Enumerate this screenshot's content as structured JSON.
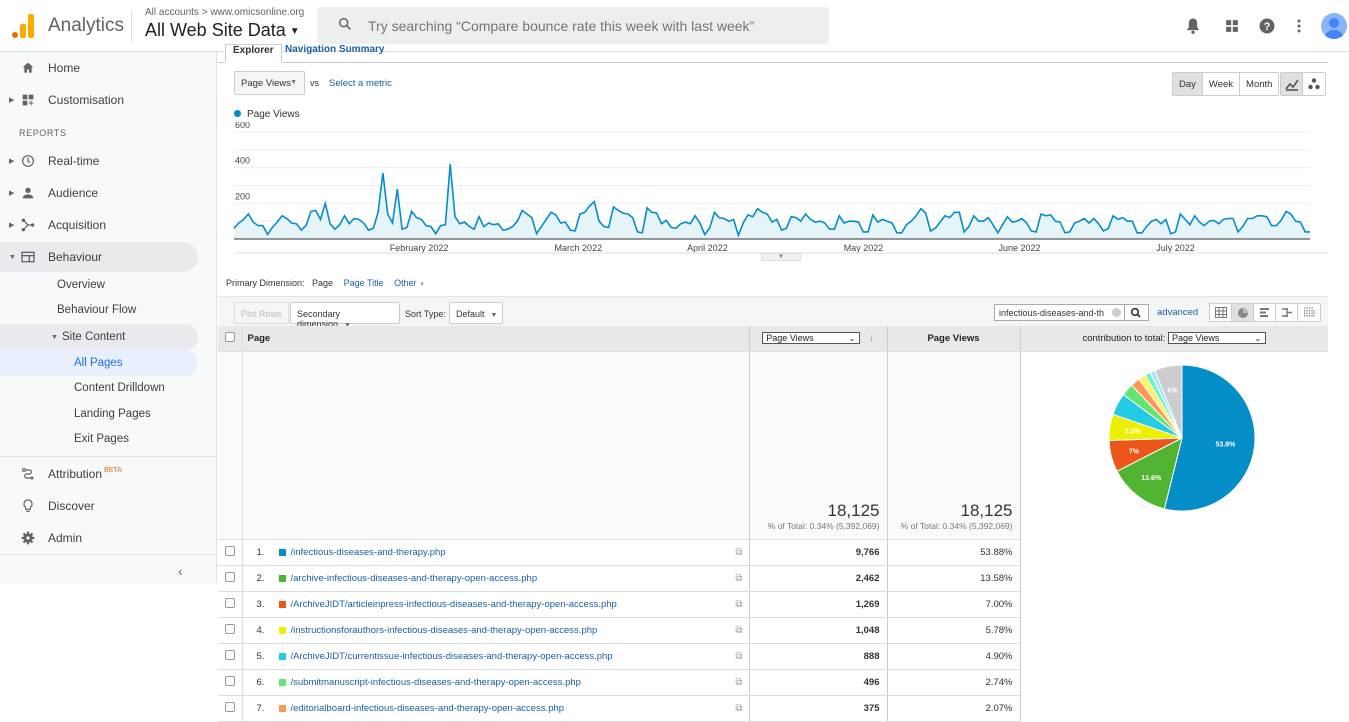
{
  "header": {
    "app_name": "Analytics",
    "breadcrumb": "All accounts > www.omicsonline.org",
    "property": "All Web Site Data",
    "search_placeholder": "Try searching “Compare bounce rate this week with last week”",
    "icons": [
      "bell-icon",
      "apps-grid-icon",
      "help-icon",
      "more-vert-icon",
      "avatar"
    ]
  },
  "sidebar": {
    "items": [
      {
        "label": "Home",
        "icon": "home-icon"
      },
      {
        "label": "Customisation",
        "icon": "dashboard-icon"
      },
      {
        "label": "Real-time",
        "icon": "clock-icon"
      },
      {
        "label": "Audience",
        "icon": "person-icon"
      },
      {
        "label": "Acquisition",
        "icon": "acquisition-icon"
      },
      {
        "label": "Behaviour",
        "icon": "behaviour-icon"
      }
    ],
    "reports_label": "REPORTS",
    "behaviour_sub": [
      "Overview",
      "Behaviour Flow",
      "Site Content"
    ],
    "site_content_sub": [
      "All Pages",
      "Content Drilldown",
      "Landing Pages",
      "Exit Pages"
    ],
    "bottom": [
      {
        "label": "Attribution",
        "badge": "BETA",
        "icon": "attribution-icon"
      },
      {
        "label": "Discover",
        "icon": "lightbulb-icon"
      },
      {
        "label": "Admin",
        "icon": "gear-icon"
      }
    ]
  },
  "explorer": {
    "tabs": [
      "Explorer",
      "Navigation Summary"
    ],
    "metric": "Page Views",
    "vs": "vs",
    "select_metric": "Select a metric",
    "granularity": [
      "Day",
      "Week",
      "Month"
    ],
    "granularity_selected": "Day"
  },
  "chart_data": {
    "type": "area",
    "series": [
      {
        "name": "Page Views",
        "color": "#058dc7"
      }
    ],
    "yticks": [
      "600",
      "400",
      "200"
    ],
    "ylim": [
      0,
      600
    ],
    "x_labels": [
      "February 2022",
      "March 2022",
      "April 2022",
      "May 2022",
      "June 2022",
      "July 2022"
    ],
    "values": [
      60,
      90,
      110,
      140,
      95,
      75,
      75,
      25,
      65,
      95,
      130,
      115,
      90,
      85,
      50,
      75,
      155,
      160,
      110,
      200,
      85,
      55,
      80,
      130,
      85,
      115,
      110,
      90,
      50,
      60,
      150,
      370,
      140,
      90,
      280,
      55,
      65,
      155,
      120,
      110,
      75,
      70,
      30,
      75,
      80,
      420,
      125,
      85,
      95,
      70,
      55,
      125,
      70,
      90,
      80,
      85,
      50,
      55,
      70,
      100,
      160,
      140,
      120,
      30,
      70,
      110,
      150,
      135,
      90,
      95,
      50,
      45,
      140,
      150,
      185,
      210,
      100,
      70,
      65,
      180,
      160,
      145,
      140,
      120,
      40,
      35,
      175,
      150,
      145,
      85,
      105,
      65,
      60,
      85,
      95,
      85,
      130,
      90,
      25,
      60,
      150,
      120,
      115,
      100,
      110,
      20,
      90,
      135,
      125,
      170,
      150,
      140,
      95,
      110,
      50,
      60,
      125,
      120,
      100,
      140,
      110,
      95,
      100,
      90,
      55,
      55,
      130,
      90,
      100,
      100,
      95,
      40,
      40,
      135,
      95,
      110,
      100,
      90,
      35,
      35,
      80,
      100,
      130,
      170,
      145,
      45,
      60,
      95,
      130,
      120,
      150,
      150,
      40,
      70,
      130,
      100,
      100,
      120,
      80,
      35,
      80,
      125,
      95,
      100,
      115,
      90,
      45,
      40,
      140,
      130,
      135,
      100,
      95,
      35,
      40,
      90,
      100,
      115,
      90,
      115,
      85,
      45,
      60,
      130,
      110,
      120,
      100,
      100,
      35,
      35,
      70,
      100,
      110,
      85,
      110,
      30,
      40,
      140,
      110,
      80,
      130,
      95,
      75,
      100,
      105,
      85,
      110,
      115,
      115,
      40,
      70,
      115,
      115,
      130,
      130,
      125,
      75,
      75,
      105,
      155,
      140,
      100,
      95,
      40,
      40
    ]
  },
  "primary_dimension": {
    "label": "Primary Dimension:",
    "current": "Page",
    "options": [
      "Page Title",
      "Other"
    ]
  },
  "toolbar": {
    "plot_rows": "Plot Rows",
    "secondary_dimension": "Secondary dimension",
    "sort_type_label": "Sort Type:",
    "sort_type": "Default",
    "filter_value": "infectious-diseases-and-th",
    "advanced": "advanced"
  },
  "table": {
    "col_page": "Page",
    "col_metric_select": "Page Views",
    "col_metric": "Page Views",
    "contribution_label": "contribution to total:",
    "contribution_select": "Page Views",
    "totals": {
      "value1": "18,125",
      "sub1": "% of Total: 0.34% (5,392,069)",
      "value2": "18,125",
      "sub2": "% of Total: 0.34% (5,392,069)"
    },
    "rows": [
      {
        "n": "1.",
        "page": "/infectious-diseases-and-therapy.php",
        "views": "9,766",
        "pct": "53.88%",
        "color": "#058dc7"
      },
      {
        "n": "2.",
        "page": "/archive-infectious-diseases-and-therapy-open-access.php",
        "views": "2,462",
        "pct": "13.58%",
        "color": "#50b432"
      },
      {
        "n": "3.",
        "page": "/ArchiveJIDT/articleinpress-infectious-diseases-and-therapy-open-access.php",
        "views": "1,269",
        "pct": "7.00%",
        "color": "#ed561b"
      },
      {
        "n": "4.",
        "page": "/instructionsforauthors-infectious-diseases-and-therapy-open-access.php",
        "views": "1,048",
        "pct": "5.78%",
        "color": "#edef00"
      },
      {
        "n": "5.",
        "page": "/ArchiveJIDT/currentissue-infectious-diseases-and-therapy-open-access.php",
        "views": "888",
        "pct": "4.90%",
        "color": "#24cbe5"
      },
      {
        "n": "6.",
        "page": "/submitmanuscript-infectious-diseases-and-therapy-open-access.php",
        "views": "496",
        "pct": "2.74%",
        "color": "#64e572"
      },
      {
        "n": "7.",
        "page": "/editorialboard-infectious-diseases-and-therapy-open-access.php",
        "views": "375",
        "pct": "2.07%",
        "color": "#ff9655"
      }
    ]
  },
  "pie": {
    "slices": [
      {
        "value": 53.88,
        "color": "#058dc7",
        "label": "53.9%"
      },
      {
        "value": 13.58,
        "color": "#50b432",
        "label": "13.6%"
      },
      {
        "value": 7.0,
        "color": "#ed561b",
        "label": "7%"
      },
      {
        "value": 5.78,
        "color": "#edef00",
        "label": "5.8%"
      },
      {
        "value": 4.9,
        "color": "#24cbe5",
        "label": ""
      },
      {
        "value": 2.74,
        "color": "#64e572",
        "label": ""
      },
      {
        "value": 2.07,
        "color": "#ff9655",
        "label": ""
      },
      {
        "value": 1.6,
        "color": "#fff263",
        "label": ""
      },
      {
        "value": 1.3,
        "color": "#6af9c4",
        "label": ""
      },
      {
        "value": 1.1,
        "color": "#b2deff",
        "label": ""
      },
      {
        "value": 6.05,
        "color": "#cccccc",
        "label": "6%"
      }
    ]
  }
}
